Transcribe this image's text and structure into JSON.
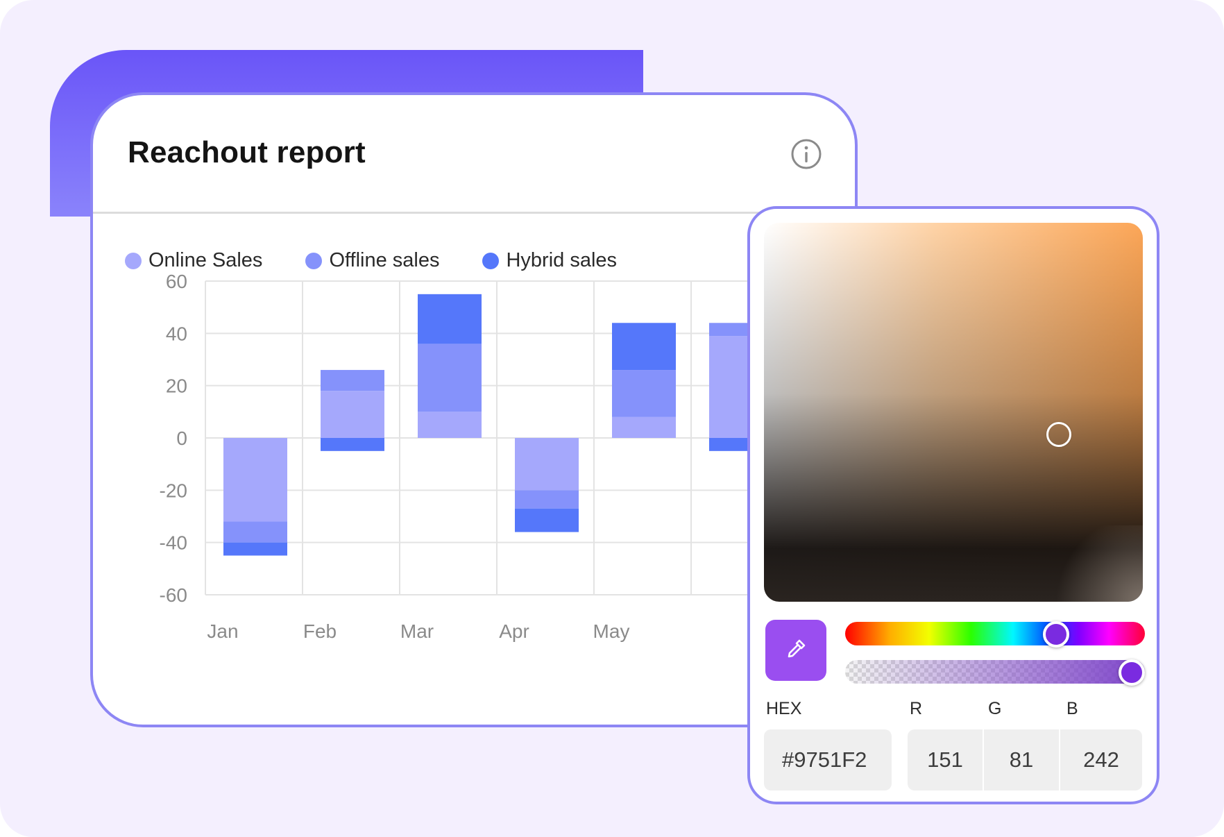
{
  "report": {
    "title": "Reachout report",
    "info_icon": "info-circle-icon"
  },
  "legend": [
    {
      "label": "Online Sales",
      "color": "#a5a8fc"
    },
    {
      "label": "Offline sales",
      "color": "#8592fb"
    },
    {
      "label": "Hybrid sales",
      "color": "#5577fa"
    }
  ],
  "chart_data": {
    "type": "bar",
    "stacked": true,
    "categories": [
      "Jan",
      "Feb",
      "Mar",
      "Apr",
      "May",
      ""
    ],
    "series": [
      {
        "name": "Online Sales",
        "color": "#a5a8fc",
        "values": [
          -32,
          18,
          10,
          -20,
          8,
          39
        ]
      },
      {
        "name": "Offline sales",
        "color": "#8592fb",
        "values": [
          -8,
          8,
          26,
          -7,
          18,
          5
        ]
      },
      {
        "name": "Hybrid sales",
        "color": "#5577fa",
        "values": [
          -5,
          -5,
          19,
          -9,
          18,
          -5
        ]
      }
    ],
    "ylim": [
      -60,
      60
    ],
    "yticks": [
      "60",
      "40",
      "20",
      "0",
      "-20",
      "-40",
      "-60"
    ],
    "grid": true,
    "xlabel": "",
    "ylabel": ""
  },
  "picker": {
    "eyedropper_icon": "eyedropper-icon",
    "hue_degrees": 270,
    "alpha": 1,
    "hex_label": "HEX",
    "hex_value": "#9751F2",
    "r_label": "R",
    "g_label": "G",
    "b_label": "B",
    "r_value": "151",
    "g_value": "81",
    "b_value": "242"
  }
}
